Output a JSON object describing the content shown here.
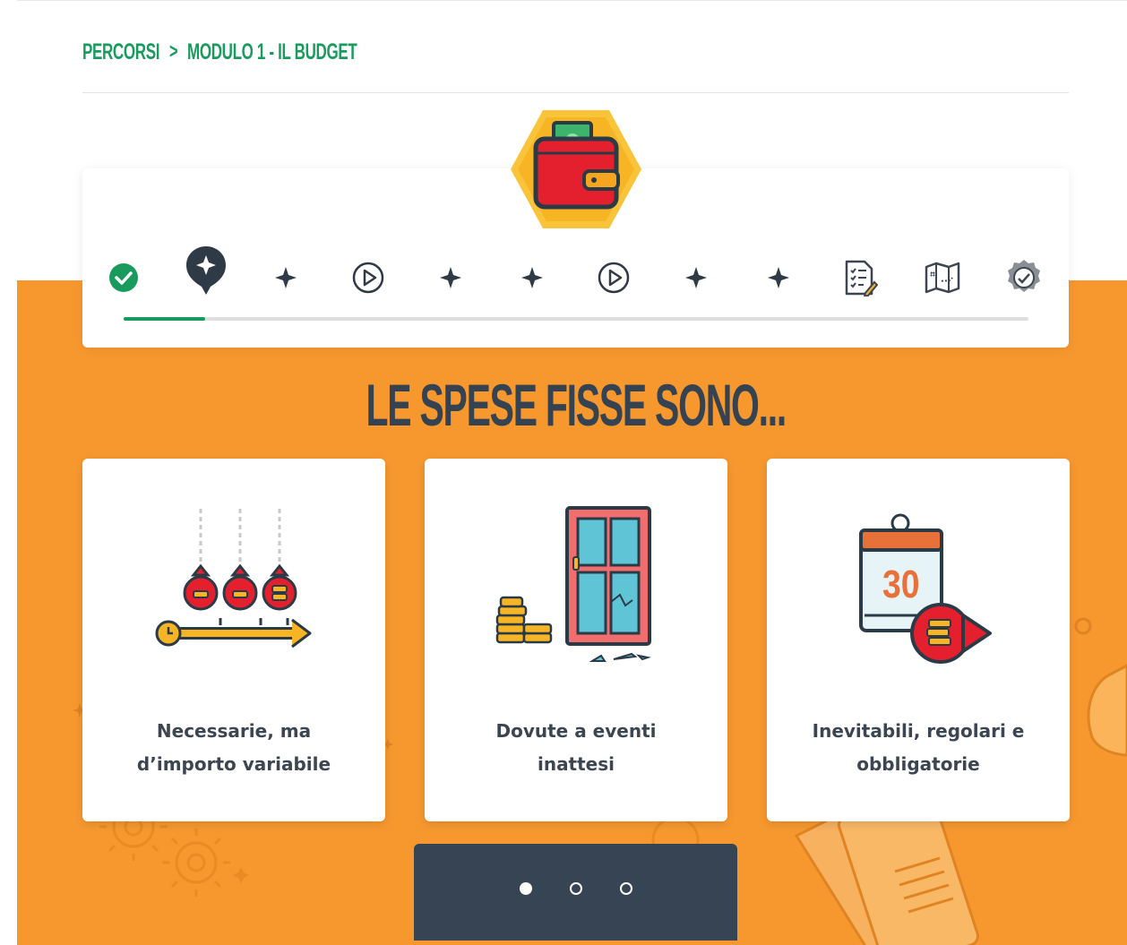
{
  "breadcrumb": {
    "root": "PERCORSI",
    "separator": ">",
    "current": "MODULO 1 - IL BUDGET"
  },
  "module_badge": {
    "icon": "wallet-icon"
  },
  "steps": [
    {
      "name": "step-completed",
      "icon": "check-circle-icon",
      "state": "completed"
    },
    {
      "name": "step-current",
      "icon": "sparkle-pin-icon",
      "state": "current"
    },
    {
      "name": "step-3",
      "icon": "sparkle-icon",
      "state": "locked"
    },
    {
      "name": "step-4",
      "icon": "play-circle-icon",
      "state": "locked"
    },
    {
      "name": "step-5",
      "icon": "sparkle-icon",
      "state": "locked"
    },
    {
      "name": "step-6",
      "icon": "sparkle-icon",
      "state": "locked"
    },
    {
      "name": "step-7",
      "icon": "play-circle-icon",
      "state": "locked"
    },
    {
      "name": "step-8",
      "icon": "sparkle-icon",
      "state": "locked"
    },
    {
      "name": "step-9",
      "icon": "sparkle-icon",
      "state": "locked"
    },
    {
      "name": "step-10",
      "icon": "quiz-document-icon",
      "state": "locked"
    },
    {
      "name": "step-11",
      "icon": "map-icon",
      "state": "locked"
    },
    {
      "name": "step-12",
      "icon": "certificate-badge-icon",
      "state": "locked"
    }
  ],
  "progress_fraction": 0.09,
  "question": "LE SPESE FISSE SONO...",
  "answers": [
    {
      "icon": "money-bags-timeline-icon",
      "label_line1": "Necessarie, ma",
      "label_line2": "d’importo variabile"
    },
    {
      "icon": "broken-window-coins-icon",
      "label_line1": "Dovute a eventi",
      "label_line2": "inattesi"
    },
    {
      "icon": "calendar-30-payment-icon",
      "label_line1": "Inevitabili, regolari e",
      "label_line2": "obbligatorie"
    }
  ],
  "pager": {
    "pages": 3,
    "active_index": 0
  },
  "colors": {
    "brand_green": "#1a9b5e",
    "dark_navy": "#374454",
    "orange_bg": "#f7982f",
    "badge_yellow": "#f9c43a",
    "icon_red": "#e5202e"
  }
}
